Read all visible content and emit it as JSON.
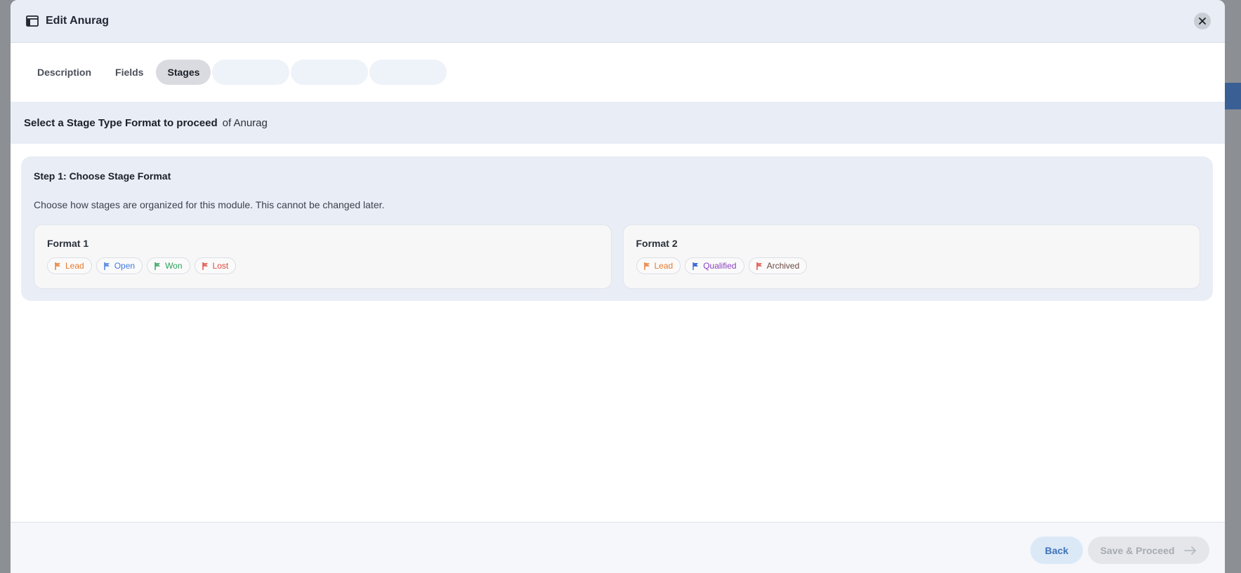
{
  "modal": {
    "title": "Edit Anurag"
  },
  "tabs": [
    {
      "label": "Description",
      "active": false
    },
    {
      "label": "Fields",
      "active": false
    },
    {
      "label": "Stages",
      "active": true
    }
  ],
  "section": {
    "title": "Select a Stage Type Format to proceed",
    "subtitle": "of Anurag"
  },
  "step": {
    "title": "Step 1: Choose Stage Format",
    "description": "Choose how stages are organized for this module. This cannot be changed later."
  },
  "formats": [
    {
      "title": "Format 1",
      "stages": [
        {
          "label": "Lead",
          "color": "#e8792b"
        },
        {
          "label": "Open",
          "color": "#3f7be0"
        },
        {
          "label": "Won",
          "color": "#2aa05a"
        },
        {
          "label": "Lost",
          "color": "#e2483d"
        }
      ]
    },
    {
      "title": "Format 2",
      "stages": [
        {
          "label": "Lead",
          "color": "#e8792b"
        },
        {
          "label": "Qualified",
          "color": "#8a3fc0",
          "flag_color": "#3f6fd6"
        },
        {
          "label": "Archived",
          "color": "#6a4a44",
          "flag_color": "#e2483d"
        }
      ]
    }
  ],
  "footer": {
    "back_label": "Back",
    "save_label": "Save & Proceed"
  }
}
